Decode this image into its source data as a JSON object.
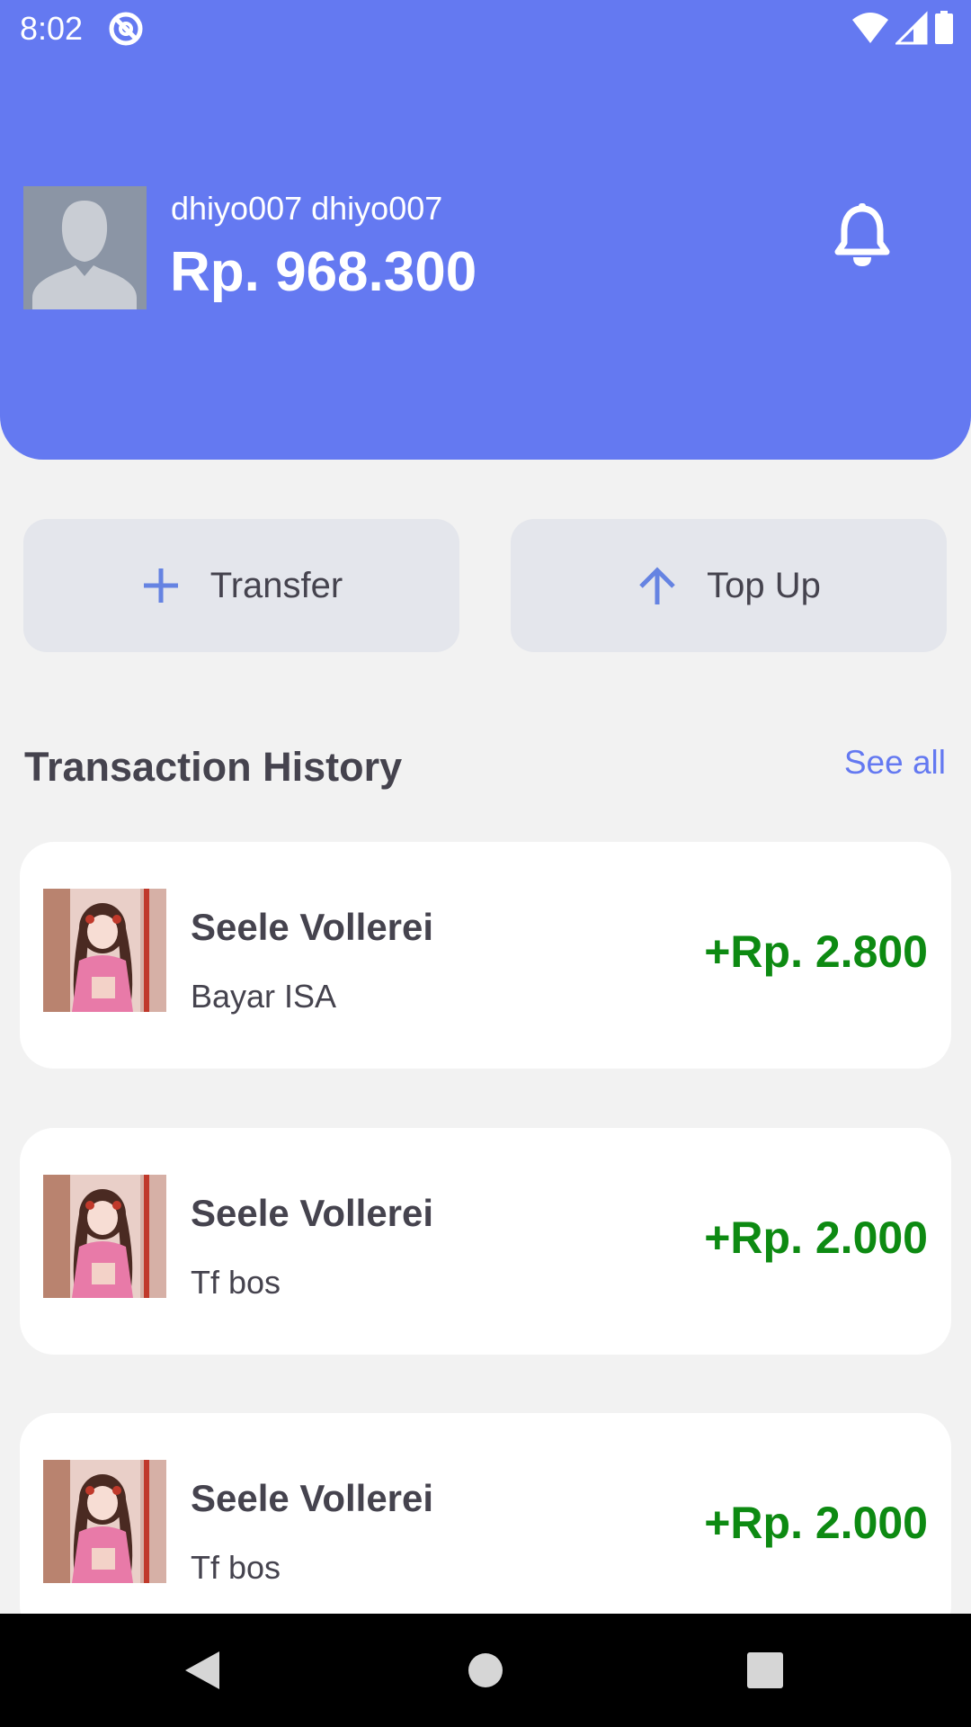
{
  "status_bar": {
    "time": "8:02",
    "icons": [
      "app-notification-icon",
      "wifi-icon",
      "signal-icon",
      "battery-icon"
    ]
  },
  "header": {
    "username": "dhiyo007 dhiyo007",
    "balance": "Rp. 968.300",
    "background_color": "#6479f1"
  },
  "actions": {
    "transfer_label": "Transfer",
    "topup_label": "Top Up",
    "icon_color": "#6583e2"
  },
  "transactions_section": {
    "title": "Transaction History",
    "see_all_label": "See all"
  },
  "transactions": [
    {
      "name": "Seele Vollerei",
      "note": "Bayar ISA",
      "amount": "+Rp. 2.800"
    },
    {
      "name": "Seele Vollerei",
      "note": "Tf bos",
      "amount": "+Rp. 2.000"
    },
    {
      "name": "Seele Vollerei",
      "note": "Tf bos",
      "amount": "+Rp. 2.000"
    }
  ],
  "amount_color": "#0d8a12",
  "nav_bar": {
    "icons": [
      "back-icon",
      "home-icon",
      "recents-icon"
    ]
  }
}
